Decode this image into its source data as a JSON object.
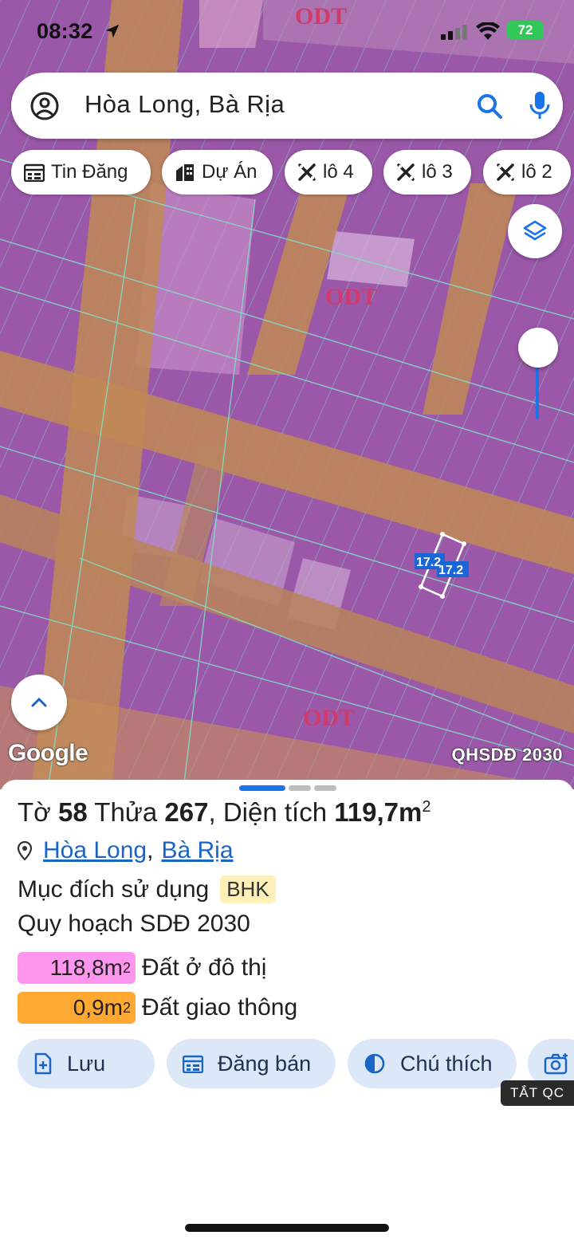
{
  "status_bar": {
    "time": "08:32",
    "battery": "72"
  },
  "search": {
    "query": "Hòa Long, Bà Rịa"
  },
  "chips": [
    {
      "label": "Tin Đăng",
      "icon": "calendar-icon"
    },
    {
      "label": "Dự Án",
      "icon": "building-icon"
    },
    {
      "label": "lô 4",
      "icon": "tools-icon"
    },
    {
      "label": "lô 3",
      "icon": "tools-icon"
    },
    {
      "label": "lô 2",
      "icon": "tools-icon"
    }
  ],
  "map": {
    "zone_labels": [
      "ODT",
      "ODT",
      "ODT"
    ],
    "parcel_dims": [
      "17.2",
      "17.2"
    ],
    "attribution": "Google",
    "layer_name": "QHSDĐ 2030",
    "zoom_level": 0.4
  },
  "parcel": {
    "prefix_to": "Tờ",
    "to_value": "58",
    "prefix_thua": "Thửa",
    "thua_value": "267",
    "area_label": ", Diện tích",
    "area_value": "119,7m",
    "area_unit_sup": "2",
    "ward": "Hòa Long",
    "separator": ",",
    "district": "Bà Rịa",
    "purpose_label": "Mục đích sử dụng",
    "purpose_code": "BHK",
    "plan_label": "Quy hoạch SDĐ 2030",
    "plan_rows": [
      {
        "value": "118,8m",
        "sup": "2",
        "label": "Đất ở đô thị",
        "color": "#ff96ee"
      },
      {
        "value": "0,9m",
        "sup": "2",
        "label": "Đất giao thông",
        "color": "#ffa832"
      }
    ]
  },
  "actions": [
    {
      "label": "Lưu",
      "icon": "file-add-icon"
    },
    {
      "label": "Đăng bán",
      "icon": "calendar-icon"
    },
    {
      "label": "Chú thích",
      "icon": "contrast-icon"
    },
    {
      "label": "",
      "icon": "camera-icon"
    }
  ],
  "ad_badge": "TẮT QC",
  "colors": {
    "accent": "#1a73e8",
    "urban_land": "#ff96ee",
    "road_land": "#ffa832"
  }
}
